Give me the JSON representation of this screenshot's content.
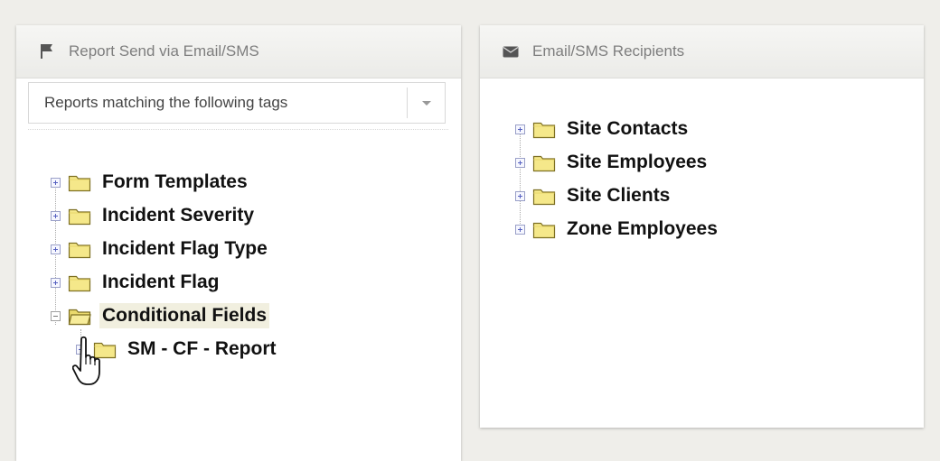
{
  "left_panel": {
    "title": "Report Send via Email/SMS",
    "header_icon": "flag-icon",
    "dropdown": {
      "selected": "Reports matching the following tags"
    },
    "tree": [
      {
        "label": "Form Templates",
        "state": "collapsed"
      },
      {
        "label": "Incident Severity",
        "state": "collapsed"
      },
      {
        "label": "Incident Flag Type",
        "state": "collapsed"
      },
      {
        "label": "Incident Flag",
        "state": "collapsed"
      },
      {
        "label": "Conditional Fields",
        "state": "expanded",
        "selected": true,
        "children": [
          {
            "label": "SM - CF - Report",
            "state": "collapsed"
          }
        ]
      }
    ]
  },
  "right_panel": {
    "title": "Email/SMS Recipients",
    "header_icon": "envelope-icon",
    "tree": [
      {
        "label": "Site Contacts",
        "state": "collapsed"
      },
      {
        "label": "Site Employees",
        "state": "collapsed"
      },
      {
        "label": "Site Clients",
        "state": "collapsed"
      },
      {
        "label": "Zone Employees",
        "state": "collapsed"
      }
    ]
  },
  "colors": {
    "folder_fill": "#f5e88a",
    "folder_stroke": "#8a7a2a",
    "selected_bg": "#f1efdf"
  }
}
